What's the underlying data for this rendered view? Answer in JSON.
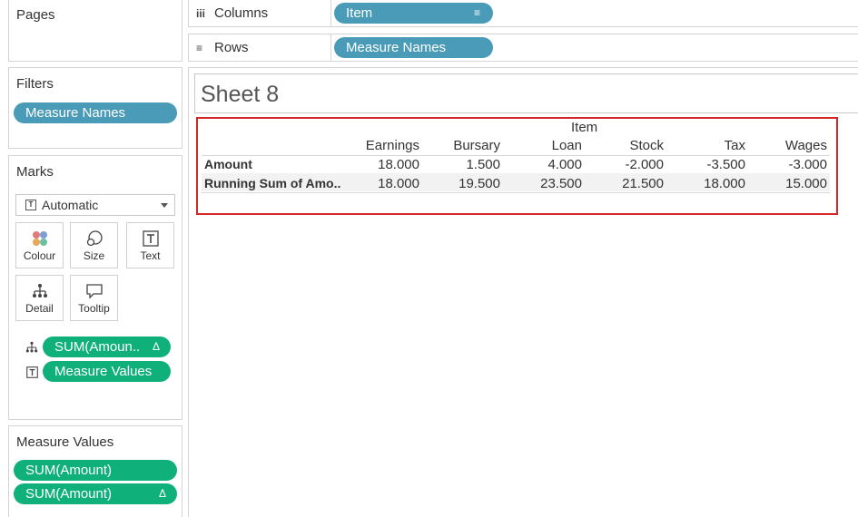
{
  "left_panel": {
    "pages": {
      "title": "Pages"
    },
    "filters": {
      "title": "Filters",
      "pills": [
        "Measure Names"
      ]
    },
    "marks": {
      "title": "Marks",
      "mark_type": "Automatic",
      "buttons": [
        {
          "label": "Colour",
          "icon": "colour-dots-icon"
        },
        {
          "label": "Size",
          "icon": "size-circles-icon"
        },
        {
          "label": "Text",
          "icon": "text-t-icon"
        },
        {
          "label": "Detail",
          "icon": "detail-tree-icon"
        },
        {
          "label": "Tooltip",
          "icon": "tooltip-bubble-icon"
        }
      ],
      "fields": [
        {
          "label": "SUM(Amoun..",
          "icon": "detail-tree-icon",
          "delta": "Δ"
        },
        {
          "label": "Measure Values",
          "icon": "text-t-icon",
          "delta": ""
        }
      ]
    },
    "measure_values": {
      "title": "Measure Values",
      "pills": [
        {
          "label": "SUM(Amount)",
          "delta": ""
        },
        {
          "label": "SUM(Amount)",
          "delta": "Δ"
        }
      ]
    }
  },
  "shelves": {
    "columns": {
      "label": "Columns",
      "icon": "iii",
      "pill": "Item"
    },
    "rows": {
      "label": "Rows",
      "icon": "≡",
      "pill": "Measure Names"
    }
  },
  "sheet": {
    "title": "Sheet 8",
    "column_group": "Item",
    "columns": [
      "Earnings",
      "Bursary",
      "Loan",
      "Stock",
      "Tax",
      "Wages"
    ],
    "rows": [
      {
        "label": "Amount",
        "values": [
          "18.000",
          "1.500",
          "4.000",
          "-2.000",
          "-3.500",
          "-3.000"
        ]
      },
      {
        "label": "Running Sum of Amo..",
        "values": [
          "18.000",
          "19.500",
          "23.500",
          "21.500",
          "18.000",
          "15.000"
        ]
      }
    ]
  },
  "colors": {
    "filter_pill": "#4a9bb8",
    "measure_pill": "#0fb079",
    "highlight_border": "#d62728"
  }
}
